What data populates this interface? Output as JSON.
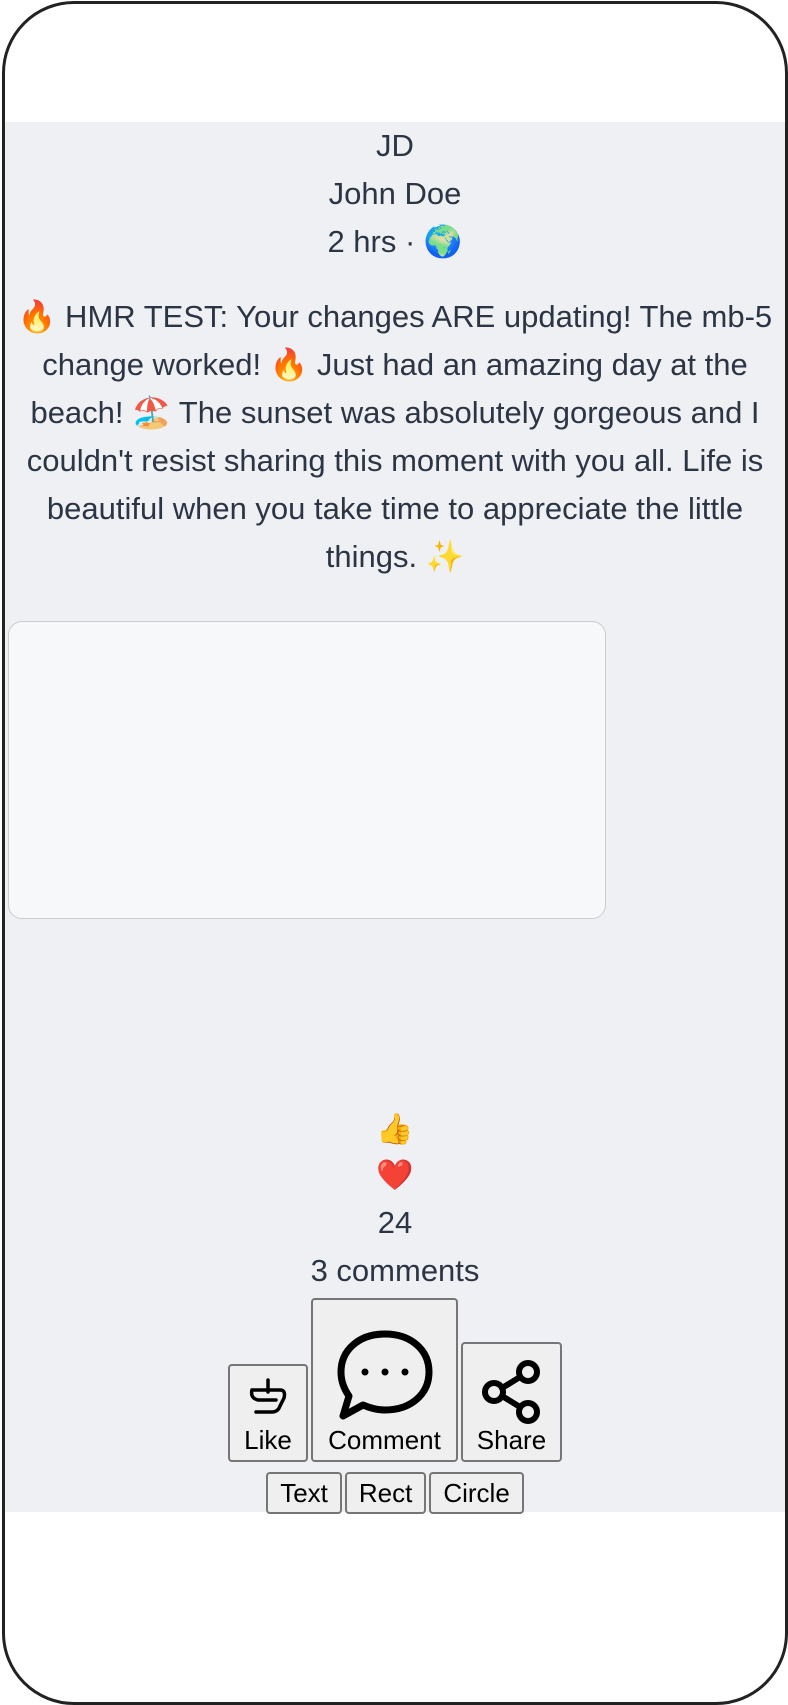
{
  "post": {
    "avatar_initials": "JD",
    "author": "John Doe",
    "meta": "2 hrs · 🌍",
    "text": "🔥 HMR TEST: Your changes ARE updating! The mb-5 change worked! 🔥 Just had an amazing day at the beach! 🏖️ The sunset was absolutely gorgeous and I couldn't resist sharing this moment with you all. Life is beautiful when you take time to appreciate the little things. ✨"
  },
  "reactions": {
    "like_emoji": "👍",
    "love_emoji": "❤️",
    "count": "24",
    "comments": "3 comments"
  },
  "actions": {
    "like_label": "Like",
    "comment_label": "Comment",
    "share_label": "Share",
    "like_icon": "like-hand-icon",
    "comment_icon": "speech-bubble-icon",
    "share_icon": "share-nodes-icon"
  },
  "tools": {
    "text_label": "Text",
    "rect_label": "Rect",
    "circle_label": "Circle"
  }
}
